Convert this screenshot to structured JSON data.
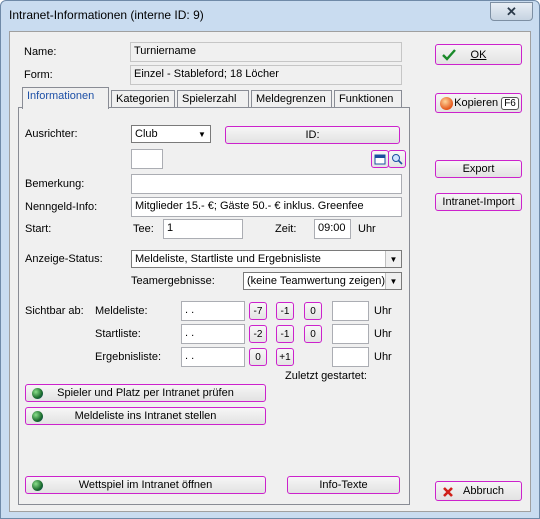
{
  "window": {
    "title": "Intranet-Informationen (interne ID: 9)",
    "close_symbol": "✕"
  },
  "header": {
    "name_label": "Name:",
    "name_value": "Turniername",
    "form_label": "Form:",
    "form_value": "Einzel - Stableford; 18 Löcher"
  },
  "tabs": [
    "Informationen",
    "Kategorien",
    "Spielerzahl",
    "Meldegrenzen",
    "Funktionen"
  ],
  "info": {
    "ausrichter_label": "Ausrichter:",
    "ausrichter_value": "Club",
    "id_button": "ID:",
    "bemerkung_label": "Bemerkung:",
    "bemerkung_value": "",
    "nenngeld_label": "Nenngeld-Info:",
    "nenngeld_value": "Mitglieder 15.- €; Gäste 50.- € inklus. Greenfee",
    "start_label": "Start:",
    "tee_label": "Tee:",
    "tee_value": "1",
    "zeit_label": "Zeit:",
    "zeit_value": "09:00",
    "uhr_label": "Uhr",
    "anzeige_label": "Anzeige-Status:",
    "anzeige_value": "Meldeliste, Startliste und Ergebnisliste",
    "team_label": "Teamergebnisse:",
    "team_value": "(keine Teamwertung zeigen)",
    "sichtbar_label": "Sichtbar ab:",
    "rows": [
      {
        "label": "Meldeliste:",
        "date": " .  .",
        "buttons": [
          "-7",
          "-1",
          "0"
        ]
      },
      {
        "label": "Startliste:",
        "date": " .  .",
        "buttons": [
          "-2",
          "-1",
          "0"
        ]
      },
      {
        "label": "Ergebnisliste:",
        "date": " .  .",
        "buttons": [
          "0",
          "+1"
        ]
      }
    ],
    "zuletzt_label": "Zuletzt gestartet:",
    "btn_pruefen": "Spieler und Platz per Intranet prüfen",
    "btn_meldeliste": "Meldeliste ins Intranet stellen",
    "btn_wettspiel": "Wettspiel im Intranet öffnen",
    "btn_infotexte": "Info-Texte"
  },
  "side": {
    "ok": "OK",
    "kopieren": "Kopieren",
    "kopieren_key": "F6",
    "export": "Export",
    "import": "Intranet-Import",
    "abbruch": "Abbruch"
  }
}
